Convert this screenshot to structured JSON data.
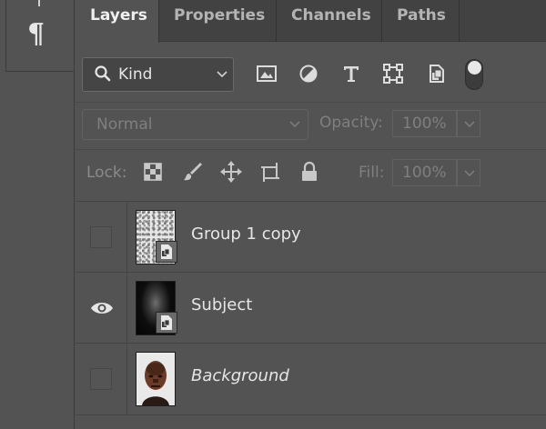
{
  "toolbar": {
    "paragraph_glyph": "¶"
  },
  "tabs": [
    {
      "label": "Layers",
      "active": true
    },
    {
      "label": "Properties",
      "active": false
    },
    {
      "label": "Channels",
      "active": false
    },
    {
      "label": "Paths",
      "active": false
    }
  ],
  "filter": {
    "kind_label": "Kind",
    "icons": [
      "image-filter-icon",
      "adjustment-filter-icon",
      "type-filter-icon",
      "shape-filter-icon",
      "smart-object-filter-icon"
    ],
    "toggle_on": true
  },
  "blend": {
    "mode": "Normal",
    "opacity_label": "Opacity:",
    "opacity_value": "100%"
  },
  "lock": {
    "label": "Lock:",
    "icons": [
      "lock-transparent-pixels-icon",
      "lock-image-pixels-icon",
      "lock-position-icon",
      "lock-artboard-icon",
      "lock-all-icon"
    ],
    "fill_label": "Fill:",
    "fill_value": "100%"
  },
  "layers": [
    {
      "name": "Group 1 copy",
      "visible": false,
      "smart_object": true,
      "italic": false
    },
    {
      "name": "Subject",
      "visible": true,
      "smart_object": true,
      "italic": false
    },
    {
      "name": "Background",
      "visible": false,
      "smart_object": false,
      "italic": true
    }
  ],
  "colors": {
    "panel_bg": "#535353",
    "tab_bar_bg": "#424242",
    "text_active": "#f0f0f0",
    "text_disabled": "#7f7f7f"
  }
}
